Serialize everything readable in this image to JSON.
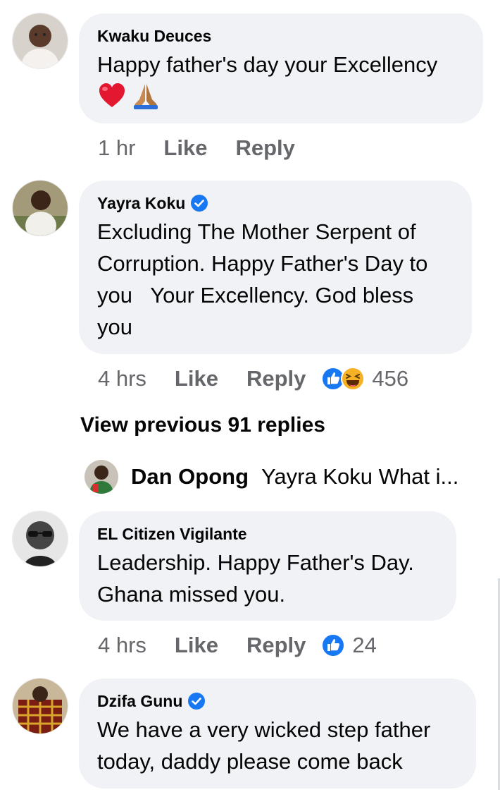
{
  "comments": [
    {
      "author": "Kwaku Deuces",
      "verified": false,
      "text": "Happy father's day your Excellency",
      "emojis": [
        "red-heart",
        "folded-hands"
      ],
      "time": "1 hr",
      "like_label": "Like",
      "reply_label": "Reply"
    },
    {
      "author": "Yayra Koku",
      "verified": true,
      "text": "Excluding The Mother Serpent of Corruption. Happy Father's Day to you   Your Excellency. God bless you",
      "time": "4 hrs",
      "like_label": "Like",
      "reply_label": "Reply",
      "reactions": [
        "like",
        "haha"
      ],
      "reaction_count": "456"
    },
    {
      "author": "EL Citizen Vigilante",
      "verified": false,
      "text": "Leadership. Happy Father's Day. Ghana missed you.",
      "time": "4 hrs",
      "like_label": "Like",
      "reply_label": "Reply",
      "reactions": [
        "like"
      ],
      "reaction_count": "24"
    },
    {
      "author": "Dzifa Gunu",
      "verified": true,
      "text": "We have a very wicked step father today, daddy please come back"
    }
  ],
  "view_previous": "View previous 91 replies",
  "reply_preview": {
    "author": "Dan Opong",
    "text": "Yayra Koku What i..."
  },
  "colors": {
    "bubble": "#f0f2f5",
    "meta": "#65676b",
    "verified": "#1877f2",
    "like": "#1877f2",
    "haha": "#f7b125"
  }
}
